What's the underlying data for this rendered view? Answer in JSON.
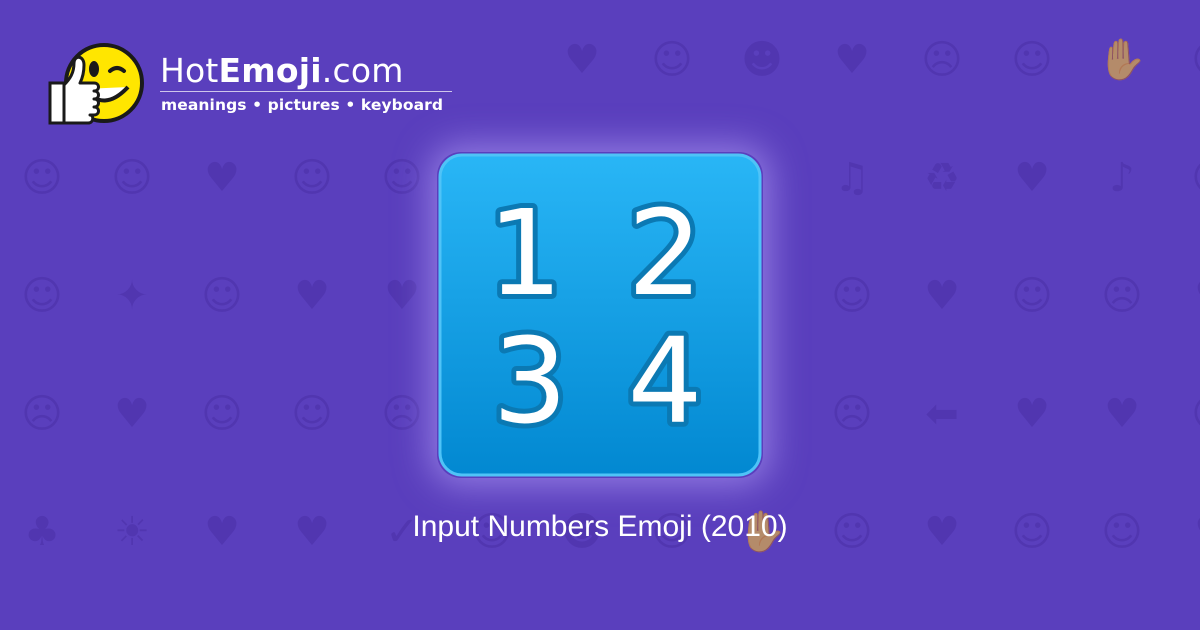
{
  "brand": {
    "name_prefix": "Hot",
    "name_strong": "Emoji",
    "name_suffix": ".com",
    "tagline": "meanings • pictures • keyboard"
  },
  "emoji": {
    "digits": [
      "1",
      "2",
      "3",
      "4"
    ],
    "icon": "input-numbers-icon"
  },
  "caption": "Input Numbers Emoji (2010)",
  "background": {
    "color": "#5a3fbd",
    "pattern_color": "#4a2fa6",
    "glyphs": [
      "♥",
      "☺",
      "☻",
      "♥",
      "☹",
      "☺",
      "✋",
      "☺",
      "☺",
      "☺",
      "♥",
      "☺",
      "☺",
      "♫",
      "♻",
      "♥",
      "♪",
      "☹",
      "☺",
      "✦",
      "☺",
      "♥",
      "♥",
      "☺",
      "♥",
      "☺",
      "☹",
      "♥",
      "☹",
      "♥",
      "☺",
      "☺",
      "☹",
      "☹",
      "⬅",
      "♥",
      "♥",
      "☺",
      "♣",
      "☀",
      "♥",
      "♥",
      "✓",
      "☺",
      "☻",
      "☺",
      "✋",
      "☺",
      "♥",
      "☺",
      "☺",
      "♥",
      "☺",
      "☺"
    ]
  },
  "colors": {
    "tile_top": "#29b6f6",
    "tile_bottom": "#0288d1",
    "digit_fill": "#ffffff",
    "digit_outline": "#0b79b3"
  }
}
